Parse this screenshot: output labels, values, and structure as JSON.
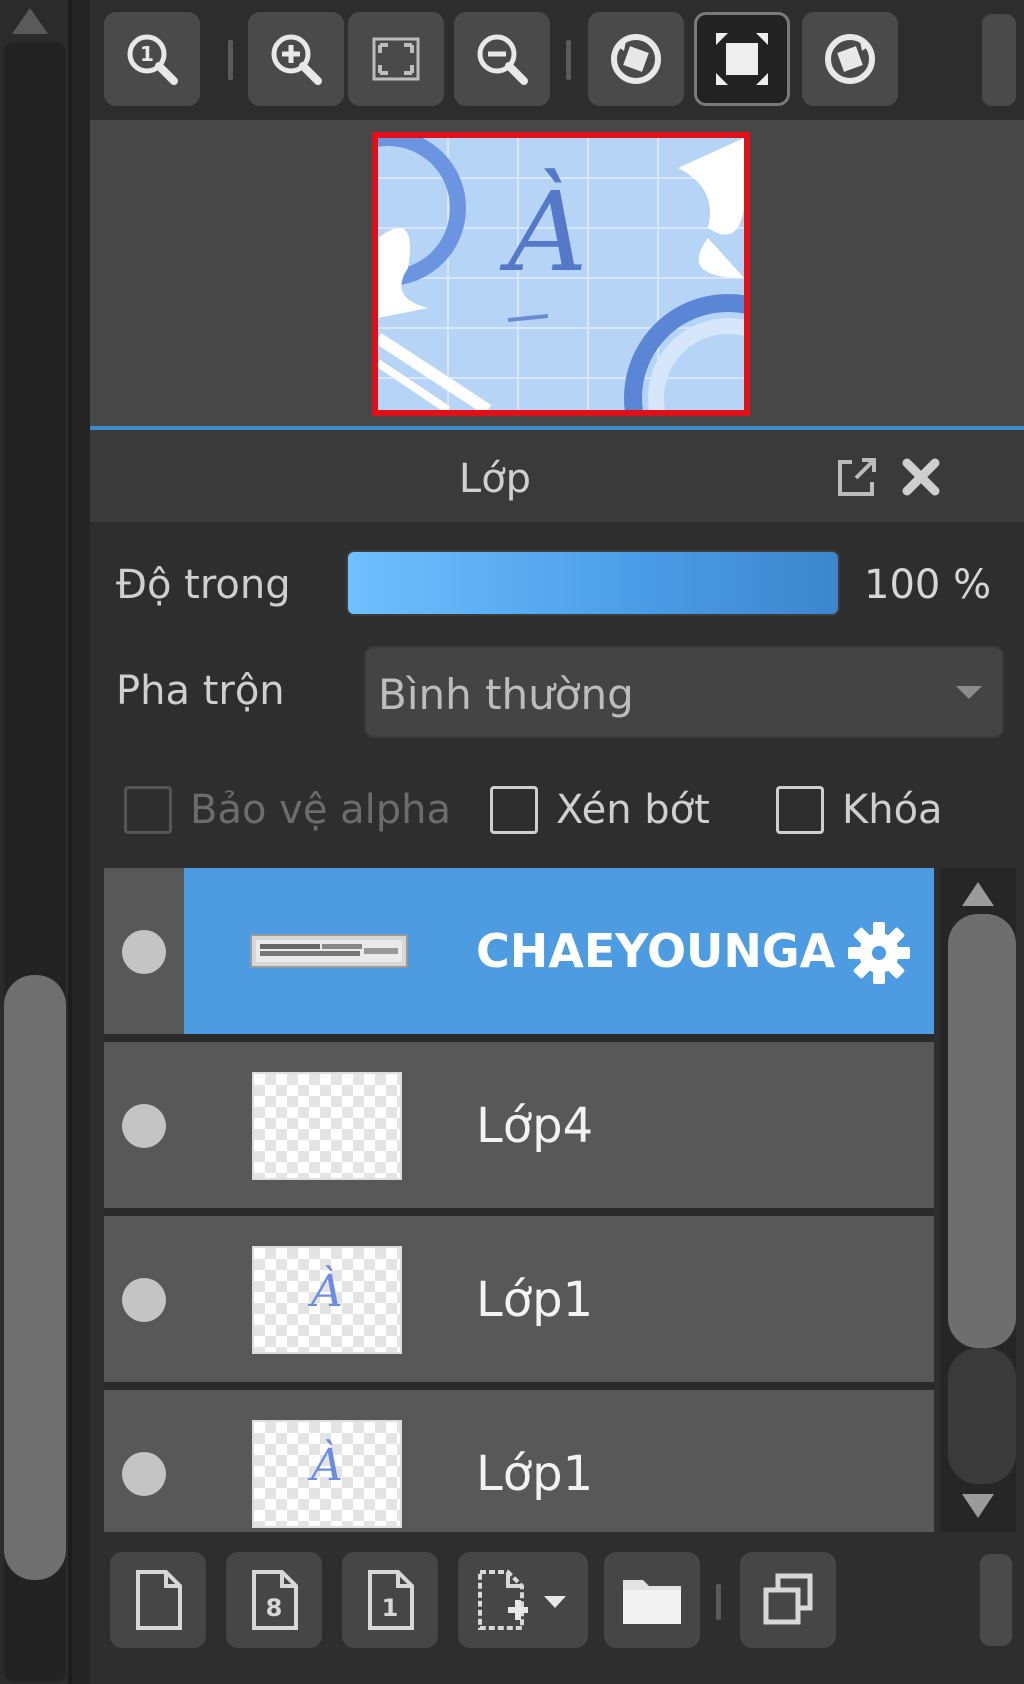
{
  "toolbar": {
    "buttons": [
      {
        "name": "zoom-actual-size-button",
        "icon": "magnifier-1-icon"
      },
      {
        "name": "zoom-in-button",
        "icon": "zoom-in-icon"
      },
      {
        "name": "fit-screen-button",
        "icon": "fit-screen-icon"
      },
      {
        "name": "zoom-out-button",
        "icon": "zoom-out-icon"
      },
      {
        "name": "rotate-left-button",
        "icon": "rotate-left-icon"
      },
      {
        "name": "fullscreen-button",
        "icon": "fullscreen-icon",
        "active": true
      },
      {
        "name": "rotate-right-button",
        "icon": "rotate-right-icon"
      }
    ]
  },
  "navigator": {
    "preview_letter": "À",
    "frame_color": "#e0101a"
  },
  "layer_panel": {
    "title": "Lớp",
    "opacity_label": "Độ trong",
    "opacity_percent": 100,
    "opacity_value": "100 %",
    "blend_label": "Pha trộn",
    "blend_value": "Bình thường",
    "checkboxes": [
      {
        "label": "Bảo vệ alpha",
        "checked": false,
        "disabled": true
      },
      {
        "label": "Xén bớt",
        "checked": false,
        "disabled": false
      },
      {
        "label": "Khóa",
        "checked": false,
        "disabled": false
      }
    ],
    "layers": [
      {
        "name": "CHAEYOUNGA",
        "selected": true,
        "thumb": "text"
      },
      {
        "name": "Lớp4",
        "selected": false,
        "thumb": "empty"
      },
      {
        "name": "Lớp1",
        "selected": false,
        "thumb": "letter",
        "thumb_letter": "À"
      },
      {
        "name": "Lớp1",
        "selected": false,
        "thumb": "letter",
        "thumb_letter": "À"
      }
    ]
  },
  "bottom_toolbar": {
    "buttons": [
      {
        "name": "new-layer-button",
        "icon": "new-page-icon"
      },
      {
        "name": "new-8bit-layer-button",
        "icon": "page-8-icon"
      },
      {
        "name": "new-1bit-layer-button",
        "icon": "page-1-icon"
      },
      {
        "name": "add-layer-menu-button",
        "icon": "add-page-dropdown-icon"
      },
      {
        "name": "new-folder-button",
        "icon": "folder-icon"
      },
      {
        "name": "duplicate-layer-button",
        "icon": "duplicate-icon"
      }
    ]
  },
  "colors": {
    "accent": "#4d9be0",
    "divider": "#3b8bd0"
  }
}
